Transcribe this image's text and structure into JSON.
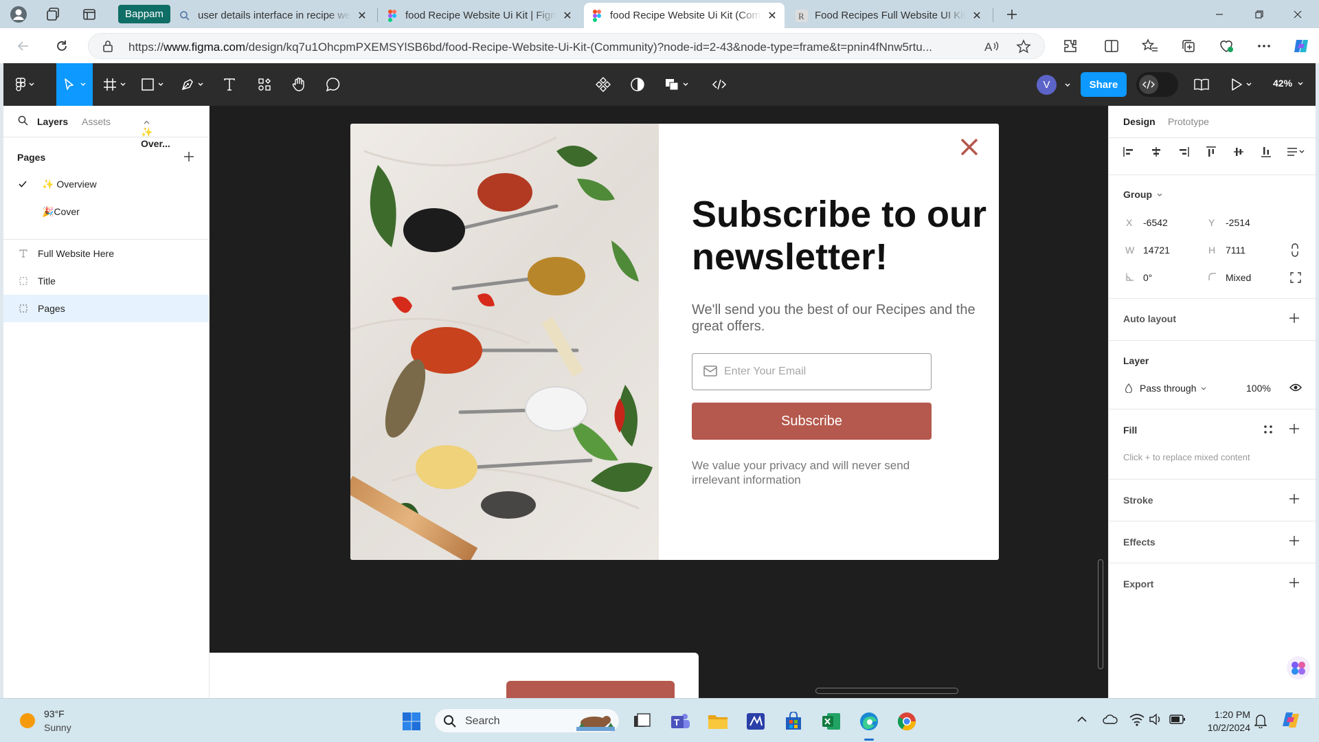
{
  "browser": {
    "profile_chip": "Bappam",
    "tabs": [
      {
        "title": "user details interface in recipe web"
      },
      {
        "title": "food Recipe Website Ui Kit | Figma"
      },
      {
        "title": "food Recipe Website Ui Kit (Community)"
      },
      {
        "title": "Food Recipes Full Website UI Kit"
      }
    ],
    "url_prefix": "https://",
    "url_host": "www.figma.com",
    "url_rest": "/design/kq7u1OhcpmPXEMSYlSB6bd/food-Recipe-Website-Ui-Kit-(Community)?node-id=2-43&node-type=frame&t=pnin4fNnw5rtu..."
  },
  "figma": {
    "user_initial": "V",
    "share_label": "Share",
    "zoom": "42%",
    "left_panel": {
      "tab_layers": "Layers",
      "tab_assets": "Assets",
      "page_dropdown": "✨ Over...",
      "pages_title": "Pages",
      "pages": [
        {
          "label": "✨ Overview",
          "current": true
        },
        {
          "label": "🎉Cover",
          "current": false
        }
      ],
      "layers": [
        {
          "label": "Full Website Here",
          "type": "text"
        },
        {
          "label": "Title",
          "type": "frame"
        },
        {
          "label": "Pages",
          "type": "frame",
          "selected": true
        }
      ]
    },
    "canvas": {
      "newsletter": {
        "title": "Subscribe to our newsletter!",
        "subtitle": "We'll send you the best of our Recipes and the great offers.",
        "email_placeholder": "Enter Your Email",
        "email_value": "",
        "button": "Subscribe",
        "privacy": "We value your privacy and will never send irrelevant information",
        "accent": "#b5584d"
      }
    },
    "right_panel": {
      "tab_design": "Design",
      "tab_prototype": "Prototype",
      "group_title": "Group",
      "x_label": "X",
      "x_value": "-6542",
      "y_label": "Y",
      "y_value": "-2514",
      "w_label": "W",
      "w_value": "14721",
      "h_label": "H",
      "h_value": "7111",
      "rotation": "0°",
      "radius": "Mixed",
      "auto_layout": "Auto layout",
      "layer_title": "Layer",
      "blend_mode": "Pass through",
      "opacity": "100%",
      "fill_title": "Fill",
      "fill_hint": "Click + to replace mixed content",
      "stroke_title": "Stroke",
      "effects_title": "Effects",
      "export_title": "Export"
    }
  },
  "taskbar": {
    "weather_temp": "93°F",
    "weather_desc": "Sunny",
    "search_label": "Search",
    "time": "1:20 PM",
    "date": "10/2/2024"
  }
}
